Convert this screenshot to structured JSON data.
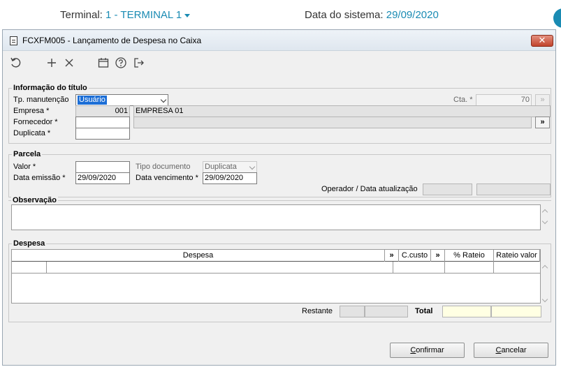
{
  "topbar": {
    "terminal_label": "Terminal:",
    "terminal_value": "1 - TERMINAL 1",
    "date_label": "Data do sistema:",
    "date_value": "29/09/2020"
  },
  "window": {
    "title": "FCXFM005 - Lançamento de Despesa no Caixa",
    "close_label": "✕"
  },
  "toolbar": [
    "undo-icon",
    "add-icon",
    "delete-icon",
    "calendar-icon",
    "help-icon",
    "exit-icon"
  ],
  "info": {
    "legend": "Informação do título",
    "tp_label": "Tp. manutenção",
    "tp_value": "Usuário",
    "cta_label": "Cta. *",
    "cta_value": "70",
    "empresa_label": "Empresa *",
    "empresa_code": "001",
    "empresa_name": "EMPRESA 01",
    "fornecedor_label": "Fornecedor *",
    "fornecedor_value": "",
    "fornecedor_btn": "»",
    "duplicata_label": "Duplicata *",
    "duplicata_value": ""
  },
  "parcela": {
    "legend": "Parcela",
    "valor_label": "Valor *",
    "valor_value": "",
    "tipo_label": "Tipo documento",
    "tipo_value": "Duplicata",
    "emissao_label": "Data emissão *",
    "emissao_value": "29/09/2020",
    "vencimento_label": "Data vencimento *",
    "vencimento_value": "29/09/2020",
    "operador_label": "Operador / Data atualização"
  },
  "observacao": {
    "legend": "Observação",
    "value": ""
  },
  "despesa": {
    "legend": "Despesa",
    "columns": [
      "Despesa",
      "»",
      "C.custo",
      "»",
      "% Rateio",
      "Rateio valor"
    ],
    "restante_label": "Restante",
    "total_label": "Total"
  },
  "buttons": {
    "confirmar": "Confirmar",
    "cancelar": "Cancelar"
  }
}
